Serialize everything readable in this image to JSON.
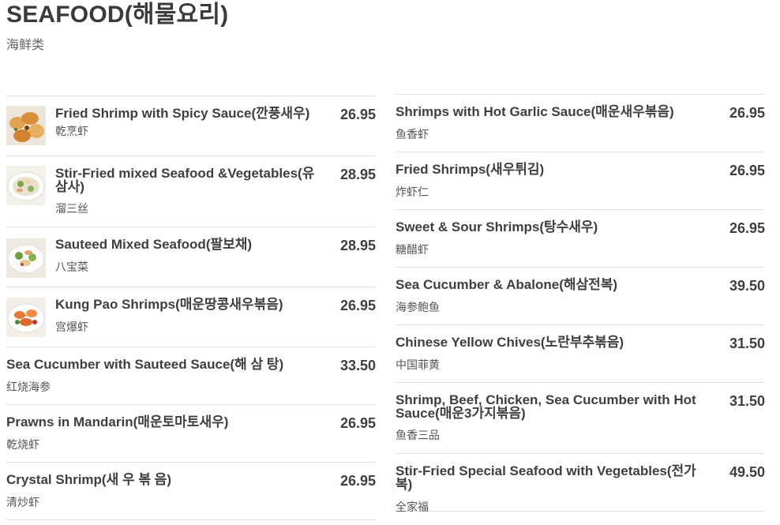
{
  "header": {
    "title": "SEAFOOD(해물요리)",
    "subtitle": "海鲜类"
  },
  "left_items": [
    {
      "name": "Fried Shrimp with Spicy Sauce(깐풍새우)",
      "price": "26.95",
      "subtitle": "乾烹虾",
      "image": "fried-shrimp-photo"
    },
    {
      "name": "Stir-Fried mixed Seafood &Vegetables(유삼사)",
      "price": "28.95",
      "subtitle": "溜三丝",
      "image": "seafood-vegetables-photo"
    },
    {
      "name": "Sauteed Mixed Seafood(팔보채)",
      "price": "28.95",
      "subtitle": "八宝菜",
      "image": "mixed-seafood-photo"
    },
    {
      "name": "Kung Pao Shrimps(매운땅콩새우볶음)",
      "price": "26.95",
      "subtitle": "宫爆虾",
      "image": "kung-pao-shrimp-photo"
    },
    {
      "name": "Sea Cucumber with Sauteed Sauce(해 삼 탕)",
      "price": "33.50",
      "subtitle": "红烧海参"
    },
    {
      "name": "Prawns in Mandarin(매운토마토새우)",
      "price": "26.95",
      "subtitle": "乾烧虾"
    },
    {
      "name": "Crystal Shrimp(새 우 볶 음)",
      "price": "26.95",
      "subtitle": "清炒虾"
    }
  ],
  "right_items": [
    {
      "name": "Shrimps with Hot Garlic Sauce(매운새우볶음)",
      "price": "26.95",
      "subtitle": "鱼香虾"
    },
    {
      "name": "Fried Shrimps(새우튀김)",
      "price": "26.95",
      "subtitle": "炸虾仁"
    },
    {
      "name": "Sweet & Sour Shrimps(탕수새우)",
      "price": "26.95",
      "subtitle": "糖醋虾"
    },
    {
      "name": "Sea Cucumber & Abalone(해삼전복)",
      "price": "39.50",
      "subtitle": "海参鲍鱼"
    },
    {
      "name": "Chinese Yellow Chives(노란부추볶음)",
      "price": "31.50",
      "subtitle": "中国菲黄"
    },
    {
      "name": "Shrimp, Beef, Chicken, Sea Cucumber with Hot Sauce(매운3가지볶음)",
      "price": "31.50",
      "subtitle": "鱼香三品"
    },
    {
      "name": "Stir-Fried Special Seafood with Vegetables(전가복)",
      "price": "49.50",
      "subtitle": "全家福"
    }
  ]
}
